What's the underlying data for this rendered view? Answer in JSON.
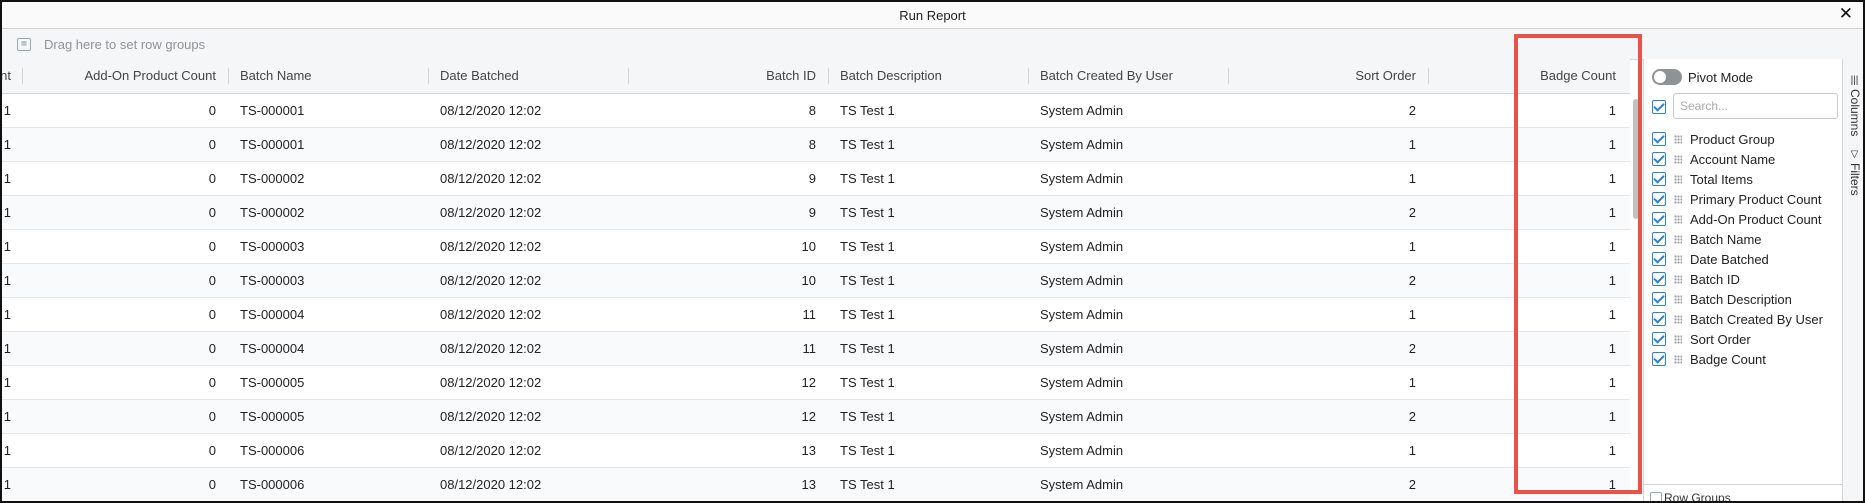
{
  "window": {
    "title": "Run Report",
    "close_glyph": "✕"
  },
  "group_bar": {
    "icon": "row-group-icon",
    "placeholder": "Drag here to set row groups"
  },
  "columns": [
    {
      "key": "primary_count",
      "label": "nt",
      "align": "right"
    },
    {
      "key": "addon_count",
      "label": "Add-On Product Count",
      "align": "right"
    },
    {
      "key": "batch_name",
      "label": "Batch Name",
      "align": "left"
    },
    {
      "key": "date_batched",
      "label": "Date Batched",
      "align": "left"
    },
    {
      "key": "batch_id",
      "label": "Batch ID",
      "align": "right"
    },
    {
      "key": "batch_description",
      "label": "Batch Description",
      "align": "left"
    },
    {
      "key": "batch_created_by",
      "label": "Batch Created By User",
      "align": "left"
    },
    {
      "key": "sort_order",
      "label": "Sort Order",
      "align": "right"
    },
    {
      "key": "badge_count",
      "label": "Badge Count",
      "align": "right"
    }
  ],
  "rows": [
    [
      "1",
      "0",
      "TS-000001",
      "08/12/2020 12:02",
      "8",
      "TS Test 1",
      "System Admin",
      "2",
      "1"
    ],
    [
      "1",
      "0",
      "TS-000001",
      "08/12/2020 12:02",
      "8",
      "TS Test 1",
      "System Admin",
      "1",
      "1"
    ],
    [
      "1",
      "0",
      "TS-000002",
      "08/12/2020 12:02",
      "9",
      "TS Test 1",
      "System Admin",
      "1",
      "1"
    ],
    [
      "1",
      "0",
      "TS-000002",
      "08/12/2020 12:02",
      "9",
      "TS Test 1",
      "System Admin",
      "2",
      "1"
    ],
    [
      "1",
      "0",
      "TS-000003",
      "08/12/2020 12:02",
      "10",
      "TS Test 1",
      "System Admin",
      "1",
      "1"
    ],
    [
      "1",
      "0",
      "TS-000003",
      "08/12/2020 12:02",
      "10",
      "TS Test 1",
      "System Admin",
      "2",
      "1"
    ],
    [
      "1",
      "0",
      "TS-000004",
      "08/12/2020 12:02",
      "11",
      "TS Test 1",
      "System Admin",
      "1",
      "1"
    ],
    [
      "1",
      "0",
      "TS-000004",
      "08/12/2020 12:02",
      "11",
      "TS Test 1",
      "System Admin",
      "2",
      "1"
    ],
    [
      "1",
      "0",
      "TS-000005",
      "08/12/2020 12:02",
      "12",
      "TS Test 1",
      "System Admin",
      "1",
      "1"
    ],
    [
      "1",
      "0",
      "TS-000005",
      "08/12/2020 12:02",
      "12",
      "TS Test 1",
      "System Admin",
      "2",
      "1"
    ],
    [
      "1",
      "0",
      "TS-000006",
      "08/12/2020 12:02",
      "13",
      "TS Test 1",
      "System Admin",
      "1",
      "1"
    ],
    [
      "1",
      "0",
      "TS-000006",
      "08/12/2020 12:02",
      "13",
      "TS Test 1",
      "System Admin",
      "2",
      "1"
    ]
  ],
  "highlight": {
    "column": "Badge Count",
    "color": "#e8524a"
  },
  "tool_panel": {
    "pivot_mode_label": "Pivot Mode",
    "pivot_mode_on": false,
    "search_placeholder": "Search...",
    "select_all_checked": true,
    "column_items": [
      {
        "label": "Product Group",
        "checked": true
      },
      {
        "label": "Account Name",
        "checked": true
      },
      {
        "label": "Total Items",
        "checked": true
      },
      {
        "label": "Primary Product Count",
        "checked": true
      },
      {
        "label": "Add-On Product Count",
        "checked": true
      },
      {
        "label": "Batch Name",
        "checked": true
      },
      {
        "label": "Date Batched",
        "checked": true
      },
      {
        "label": "Batch ID",
        "checked": true
      },
      {
        "label": "Batch Description",
        "checked": true
      },
      {
        "label": "Batch Created By User",
        "checked": true
      },
      {
        "label": "Sort Order",
        "checked": true
      },
      {
        "label": "Badge Count",
        "checked": true
      }
    ],
    "row_groups_label": "Row Groups"
  },
  "side_tabs": [
    {
      "label": "Columns",
      "icon": "columns-icon",
      "glyph": "|||",
      "active": true
    },
    {
      "label": "Filters",
      "icon": "filter-icon",
      "glyph": "▽",
      "active": false
    }
  ],
  "colors": {
    "accent": "#2c7fd6",
    "highlight": "#e8524a",
    "header_bg": "#f5f6f7",
    "row_alt_bg": "#f8fafc"
  }
}
